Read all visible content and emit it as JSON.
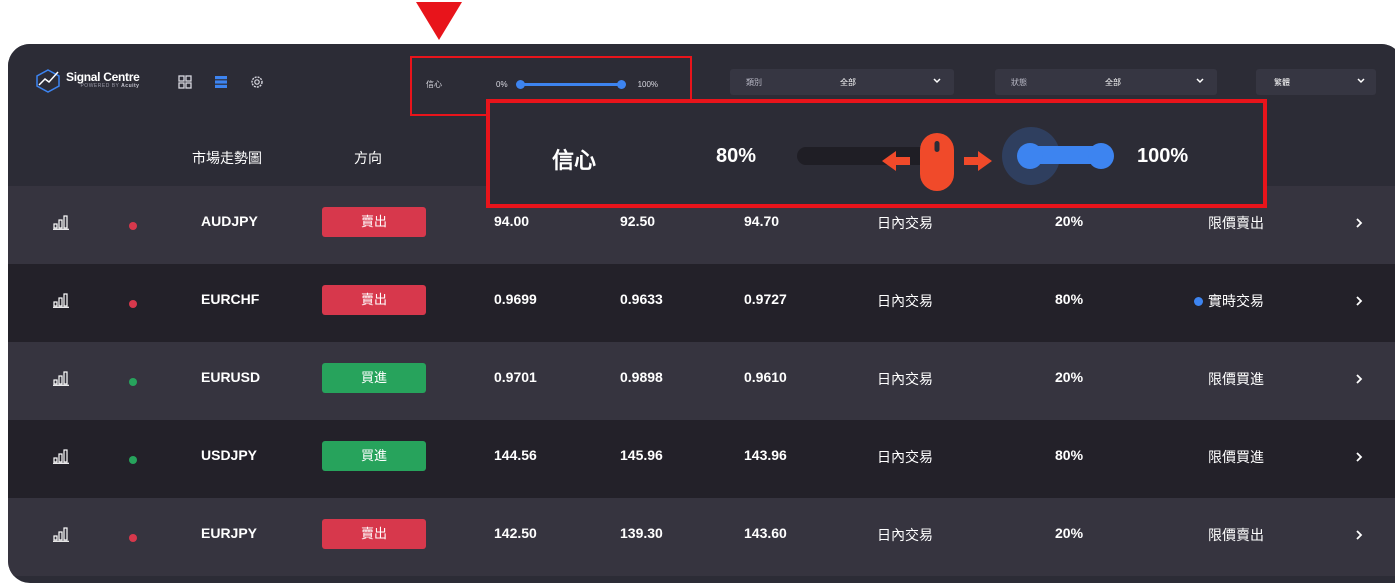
{
  "brand": {
    "name": "Signal Centre",
    "sub_prefix": "POWERED BY",
    "sub_brand": "Acuity"
  },
  "filters": {
    "confidence": {
      "label": "信心",
      "min_label": "0%",
      "max_label": "100%",
      "range": [
        0,
        100
      ]
    },
    "category": {
      "label": "類別",
      "value": "全部"
    },
    "status": {
      "label": "狀態",
      "value": "全部"
    },
    "language": {
      "value": "繁體"
    }
  },
  "callout": {
    "label": "信心",
    "min_label": "80%",
    "max_label": "100%",
    "range": [
      80,
      100
    ]
  },
  "columns": {
    "chart": "市場走勢圖",
    "direction": "方向"
  },
  "colors": {
    "sell": "#d7384c",
    "buy": "#27a35c",
    "accent": "#3d84f0",
    "highlight": "#e8141b"
  },
  "rows": [
    {
      "symbol": "AUDJPY",
      "direction": "賣出",
      "side": "sell",
      "v1": "94.00",
      "v2": "92.50",
      "v3": "94.70",
      "type": "日內交易",
      "confidence": "20%",
      "status": "限價賣出",
      "live": false
    },
    {
      "symbol": "EURCHF",
      "direction": "賣出",
      "side": "sell",
      "v1": "0.9699",
      "v2": "0.9633",
      "v3": "0.9727",
      "type": "日內交易",
      "confidence": "80%",
      "status": "實時交易",
      "live": true
    },
    {
      "symbol": "EURUSD",
      "direction": "買進",
      "side": "buy",
      "v1": "0.9701",
      "v2": "0.9898",
      "v3": "0.9610",
      "type": "日內交易",
      "confidence": "20%",
      "status": "限價買進",
      "live": false
    },
    {
      "symbol": "USDJPY",
      "direction": "買進",
      "side": "buy",
      "v1": "144.56",
      "v2": "145.96",
      "v3": "143.96",
      "type": "日內交易",
      "confidence": "80%",
      "status": "限價買進",
      "live": false
    },
    {
      "symbol": "EURJPY",
      "direction": "賣出",
      "side": "sell",
      "v1": "142.50",
      "v2": "139.30",
      "v3": "143.60",
      "type": "日內交易",
      "confidence": "20%",
      "status": "限價賣出",
      "live": false
    }
  ]
}
